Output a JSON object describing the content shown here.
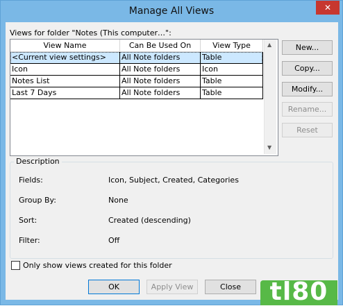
{
  "window": {
    "title": "Manage All Views",
    "close_glyph": "✕"
  },
  "list": {
    "label": "Views for folder \"Notes (This computer…\":",
    "columns": [
      "View Name",
      "Can Be Used On",
      "View Type"
    ],
    "rows": [
      {
        "name": "<Current view settings>",
        "used_on": "All Note folders",
        "type": "Table",
        "selected": true
      },
      {
        "name": "Icon",
        "used_on": "All Note folders",
        "type": "Icon",
        "selected": false
      },
      {
        "name": "Notes List",
        "used_on": "All Note folders",
        "type": "Table",
        "selected": false
      },
      {
        "name": "Last 7 Days",
        "used_on": "All Note folders",
        "type": "Table",
        "selected": false
      }
    ]
  },
  "side_buttons": {
    "new": "New...",
    "copy": "Copy...",
    "modify": "Modify...",
    "rename": "Rename...",
    "reset": "Reset"
  },
  "description": {
    "title": "Description",
    "fields_label": "Fields:",
    "fields_value": "Icon, Subject, Created, Categories",
    "group_label": "Group By:",
    "group_value": "None",
    "sort_label": "Sort:",
    "sort_value": "Created (descending)",
    "filter_label": "Filter:",
    "filter_value": "Off"
  },
  "only_show_label": "Only show views created for this folder",
  "bottom_buttons": {
    "ok": "OK",
    "apply": "Apply View",
    "close": "Close"
  },
  "watermark": "tl80"
}
